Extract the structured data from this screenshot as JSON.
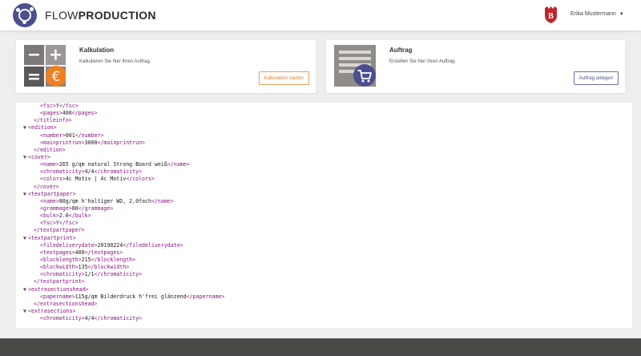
{
  "app": {
    "logo_light": "FLOW",
    "logo_bold": "PRODUCTION",
    "user_name": "Erika Mustermann",
    "brand_badge_letter": "B",
    "colors": {
      "accent_purple": "#4b4f8f",
      "accent_orange": "#f07f1e",
      "badge_red": "#c0262d"
    }
  },
  "cards": {
    "calc": {
      "title": "Kalkulation",
      "description": "Kalkulieren Sie hier Ihren Auftrag.",
      "button": "Kalkulation starten",
      "icon": "calculator-euro-icon"
    },
    "order": {
      "title": "Auftrag",
      "description": "Erstellen Sie hier Ihren Auftrag.",
      "button": "Auftrag anlegen",
      "icon": "cart-icon"
    }
  },
  "xml_lines": [
    {
      "indent": 3,
      "toggle": "",
      "open": "<fsc>",
      "value": "Y",
      "close": "</fsc>"
    },
    {
      "indent": 3,
      "toggle": "",
      "open": "<pages>",
      "value": "400",
      "close": "</pages>"
    },
    {
      "indent": 2,
      "toggle": "",
      "open": "</titleinfo>",
      "value": "",
      "close": ""
    },
    {
      "indent": 1,
      "toggle": "▼",
      "open": "<edition>",
      "value": "",
      "close": ""
    },
    {
      "indent": 3,
      "toggle": "",
      "open": "<number>",
      "value": "001",
      "close": "</number>"
    },
    {
      "indent": 3,
      "toggle": "",
      "open": "<mainprintrun>",
      "value": "3000",
      "close": "</mainprintrun>"
    },
    {
      "indent": 2,
      "toggle": "",
      "open": "</edition>",
      "value": "",
      "close": ""
    },
    {
      "indent": 1,
      "toggle": "▼",
      "open": "<cover>",
      "value": "",
      "close": ""
    },
    {
      "indent": 3,
      "toggle": "",
      "open": "<name>",
      "value": "265 g/qm natural Strong Board weiß",
      "close": "</name>"
    },
    {
      "indent": 3,
      "toggle": "",
      "open": "<chromaticity>",
      "value": "4/4",
      "close": "</chromaticity>"
    },
    {
      "indent": 3,
      "toggle": "",
      "open": "<colors>",
      "value": "4c Motiv | 4c Motiv",
      "close": "</colors>"
    },
    {
      "indent": 2,
      "toggle": "",
      "open": "</cover>",
      "value": "",
      "close": ""
    },
    {
      "indent": 1,
      "toggle": "▼",
      "open": "<textpartpaper>",
      "value": "",
      "close": ""
    },
    {
      "indent": 3,
      "toggle": "",
      "open": "<name>",
      "value": "80g/qm h'haltiger WD, 2,0fach",
      "close": "</name>"
    },
    {
      "indent": 3,
      "toggle": "",
      "open": "<grammage>",
      "value": "80",
      "close": "</grammage>"
    },
    {
      "indent": 3,
      "toggle": "",
      "open": "<bulk>",
      "value": "2.0",
      "close": "</bulk>"
    },
    {
      "indent": 3,
      "toggle": "",
      "open": "<fsc>",
      "value": "Y",
      "close": "</fsc>"
    },
    {
      "indent": 2,
      "toggle": "",
      "open": "</textpartpaper>",
      "value": "",
      "close": ""
    },
    {
      "indent": 1,
      "toggle": "▼",
      "open": "<textpartprint>",
      "value": "",
      "close": ""
    },
    {
      "indent": 3,
      "toggle": "",
      "open": "<filedeliverydate>",
      "value": "20190224",
      "close": "</filedeliverydate>"
    },
    {
      "indent": 3,
      "toggle": "",
      "open": "<textpages>",
      "value": "400",
      "close": "</textpages>"
    },
    {
      "indent": 3,
      "toggle": "",
      "open": "<blocklength>",
      "value": "215",
      "close": "</blocklength>"
    },
    {
      "indent": 3,
      "toggle": "",
      "open": "<blockwidth>",
      "value": "135",
      "close": "</blockwidth>"
    },
    {
      "indent": 3,
      "toggle": "",
      "open": "<chromaticity>",
      "value": "1/1",
      "close": "</chromaticity>"
    },
    {
      "indent": 2,
      "toggle": "",
      "open": "</textpartprint>",
      "value": "",
      "close": ""
    },
    {
      "indent": 1,
      "toggle": "▼",
      "open": "<extrasectionshead>",
      "value": "",
      "close": ""
    },
    {
      "indent": 3,
      "toggle": "",
      "open": "<papername>",
      "value": "115g/qm Bilderdruck h'frei glänzend",
      "close": "</papername>"
    },
    {
      "indent": 2,
      "toggle": "",
      "open": "</extrasectionshead>",
      "value": "",
      "close": ""
    },
    {
      "indent": 1,
      "toggle": "▼",
      "open": "<extrasections>",
      "value": "",
      "close": ""
    },
    {
      "indent": 3,
      "toggle": "",
      "open": "<chromaticity>",
      "value": "4/4",
      "close": "</chromaticity>"
    }
  ]
}
